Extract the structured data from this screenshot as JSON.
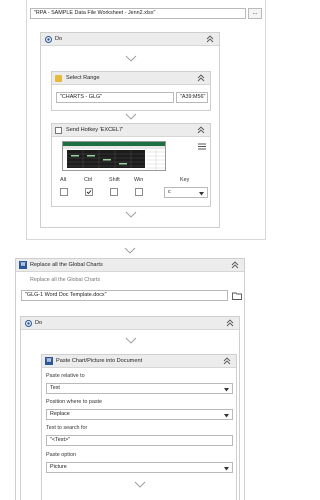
{
  "top": {
    "file_input": "\"RPA - SAMPLE Data File Worksheet - Jenn2.xlsx\"",
    "browse_label": "..."
  },
  "do_block_1": {
    "title": "Do",
    "select_range": {
      "title": "Select Range",
      "sheet_value": "\"CHARTS - GLG\"",
      "range_value": "\"A39:M56\""
    },
    "send_hotkey": {
      "title": "Send Hotkey 'EXCEL7'",
      "menu_icon": "hamburger-icon",
      "modifiers": [
        {
          "label": "Alt",
          "checked": false
        },
        {
          "label": "Ctrl",
          "checked": true
        },
        {
          "label": "Shift",
          "checked": false
        },
        {
          "label": "Win",
          "checked": false
        }
      ],
      "key_label": "Key",
      "key_value": "c"
    }
  },
  "replace_charts": {
    "title": "Replace all the Global Charts",
    "subtitle": "Replace all the Global Charts",
    "file_value": "\"GLG-1 Word Doc Template.docx\"",
    "icon": "word-icon"
  },
  "do_block_2": {
    "title": "Do",
    "paste": {
      "title": "Paste Chart/Picture into Document",
      "paste_relative_label": "Paste relative to",
      "paste_relative_value": "Text",
      "position_label": "Position where to paste",
      "position_value": "Replace",
      "search_label": "Text to search for",
      "search_value": "\"<Test>\"",
      "option_label": "Paste option",
      "option_value": "Picture"
    }
  },
  "colors": {
    "header_bg": "#ececec",
    "border": "#cfcfcf",
    "word_blue": "#2b579a",
    "excel_green": "#1d6f42"
  }
}
